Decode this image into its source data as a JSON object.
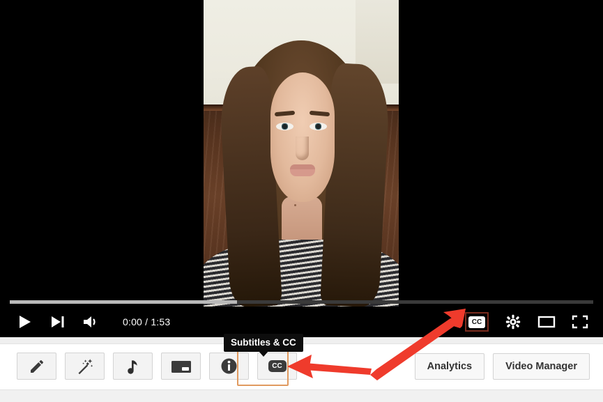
{
  "player": {
    "time_display": "0:00 / 1:53",
    "current_time": "0:00",
    "duration": "1:53",
    "progress_percent": 0,
    "buffered_percent": 39,
    "controls": [
      {
        "name": "play-button",
        "label": "Play"
      },
      {
        "name": "next-video-button",
        "label": "Next"
      },
      {
        "name": "volume-button",
        "label": "Mute"
      }
    ],
    "right_controls": [
      {
        "name": "subtitles-cc-button",
        "label": "CC",
        "highlighted": true
      },
      {
        "name": "settings-button",
        "label": "Settings"
      },
      {
        "name": "theater-mode-button",
        "label": "Theater mode"
      },
      {
        "name": "fullscreen-button",
        "label": "Full screen"
      }
    ],
    "cc_chip_label": "CC",
    "highlight_color": "#7a2b1d"
  },
  "tooltip": {
    "text": "Subtitles & CC"
  },
  "toolbar": {
    "buttons": [
      {
        "name": "edit-button",
        "icon": "pencil-icon",
        "label": "Edit"
      },
      {
        "name": "enhance-button",
        "icon": "magic-wand-icon",
        "label": "Enhancements"
      },
      {
        "name": "audio-button",
        "icon": "music-note-icon",
        "label": "Audio"
      },
      {
        "name": "end-screen-button",
        "icon": "end-screen-icon",
        "label": "End screen & Annotations"
      },
      {
        "name": "info-button",
        "icon": "info-icon",
        "label": "Info and Settings"
      },
      {
        "name": "subtitles-cc-button",
        "icon": "cc-icon",
        "label": "Subtitles & CC",
        "highlighted": true
      }
    ],
    "cc_label": "CC",
    "highlight_color": "#e09a5f",
    "right_buttons": [
      {
        "name": "analytics-button",
        "label": "Analytics"
      },
      {
        "name": "video-manager-button",
        "label": "Video Manager"
      }
    ]
  },
  "annotations": {
    "arrow_color": "#ef3b2c",
    "arrows": [
      {
        "name": "arrow-to-player-cc",
        "from": "toolbar-cc-button",
        "to": "player-cc-button"
      },
      {
        "name": "arrow-to-toolbar-cc",
        "from": "vertex",
        "to": "toolbar-cc-button"
      }
    ]
  },
  "video": {
    "orientation": "portrait",
    "description": "Woman facing camera"
  }
}
